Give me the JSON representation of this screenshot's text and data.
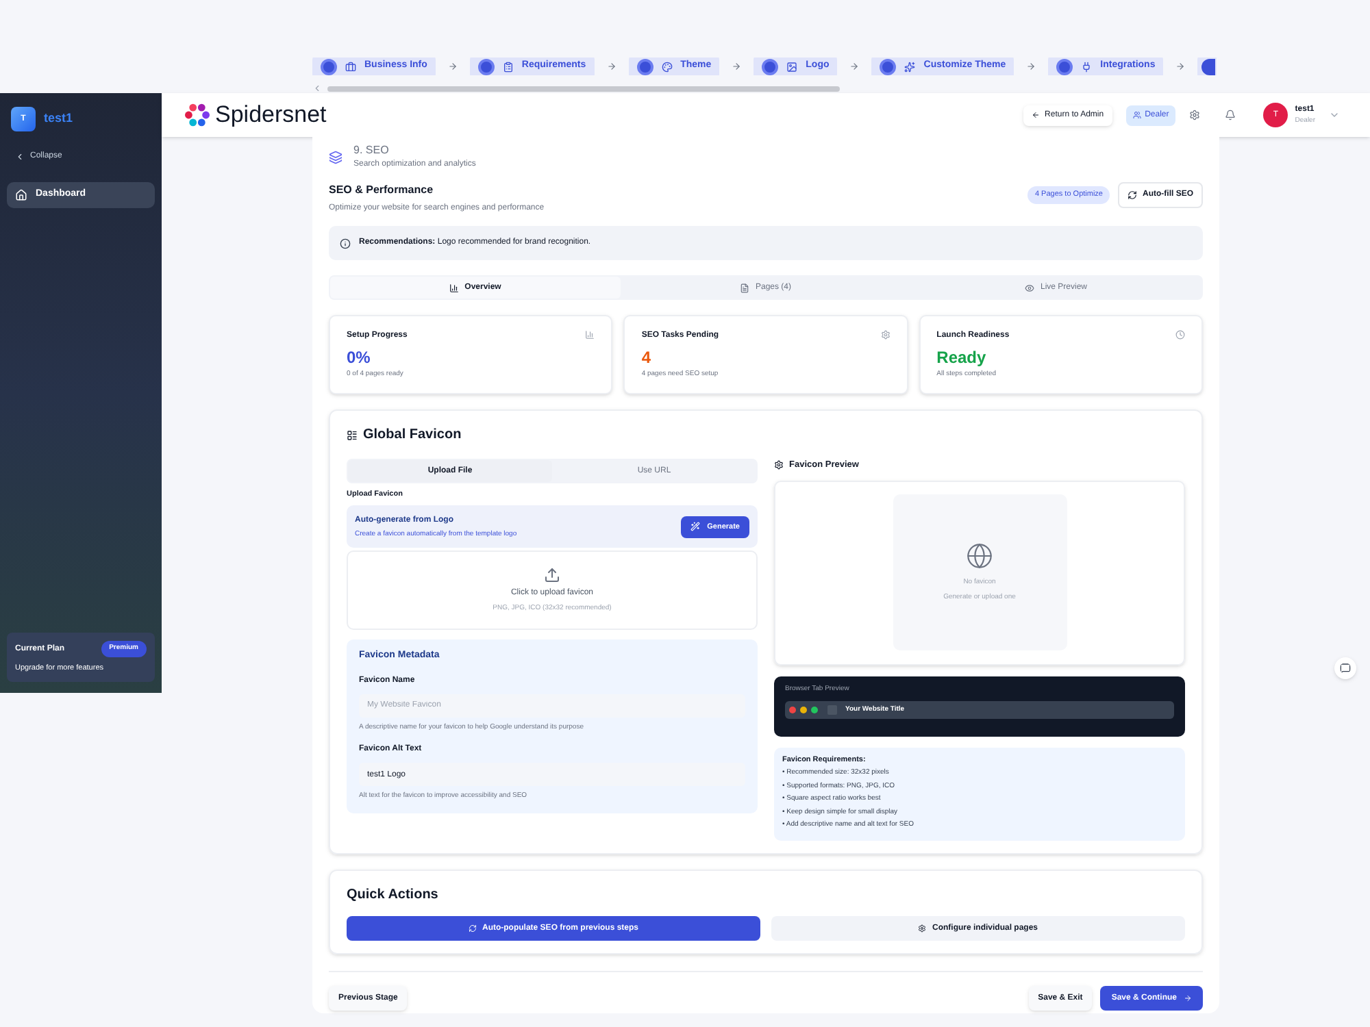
{
  "stepper": {
    "steps": [
      {
        "label": "Business Info"
      },
      {
        "label": "Requirements"
      },
      {
        "label": "Theme"
      },
      {
        "label": "Logo"
      },
      {
        "label": "Customize Theme"
      },
      {
        "label": "Integrations"
      }
    ]
  },
  "sidebar": {
    "avatar": "T",
    "name": "test1",
    "collapse": "Collapse",
    "items": [
      {
        "label": "Dashboard",
        "selected": true
      }
    ],
    "plan": {
      "label": "Current Plan",
      "badge": "Premium",
      "note": "Upgrade for more features"
    }
  },
  "header": {
    "brand": "Spidersnet",
    "return_button": "Return to Admin",
    "role_badge": "Dealer",
    "user": {
      "avatar": "T",
      "name": "test1",
      "role": "Dealer"
    }
  },
  "step": {
    "title": "9. SEO",
    "subtitle": "Search optimization and analytics"
  },
  "seo": {
    "title": "SEO & Performance",
    "subtitle": "Optimize your website for search engines and performance",
    "badge": "4 Pages to Optimize",
    "autofill_button": "Auto-fill SEO",
    "recommendation": "**Recommendations:** Logo recommended for brand recognition.",
    "tabs": [
      {
        "label": "Overview",
        "selected": true
      },
      {
        "label": "Pages (4)",
        "selected": false
      },
      {
        "label": "Live Preview",
        "selected": false
      }
    ],
    "stats": [
      {
        "label": "Setup Progress",
        "value": "0%",
        "note": "0 of 4 pages ready",
        "color": "#3b4fd8"
      },
      {
        "label": "SEO Tasks Pending",
        "value": "4",
        "note": "4 pages need SEO setup",
        "color": "#ea580c"
      },
      {
        "label": "Launch Readiness",
        "value": "Ready",
        "note": "All steps completed",
        "color": "#16a34a"
      }
    ]
  },
  "favicon": {
    "title": "Global Favicon",
    "tabs": [
      {
        "label": "Upload File",
        "selected": true
      },
      {
        "label": "Use URL",
        "selected": false
      }
    ],
    "upload_label": "Upload Favicon",
    "autogen": {
      "title": "Auto-generate from Logo",
      "subtitle": "Create a favicon automatically from the template logo",
      "button": "Generate"
    },
    "dropzone": {
      "title": "Click to upload favicon",
      "hint": "PNG, JPG, ICO (32x32 recommended)"
    },
    "metadata": {
      "title": "Favicon Metadata",
      "fields": [
        {
          "label": "Favicon Name",
          "placeholder": "My Website Favicon",
          "help": "A descriptive name for your favicon to help Google understand its purpose"
        },
        {
          "label": "Favicon Alt Text",
          "value": "test1 Logo",
          "help": "Alt text for the favicon to improve accessibility and SEO"
        }
      ]
    },
    "preview": {
      "title": "Favicon Preview",
      "empty_title": "No favicon",
      "empty_hint": "Generate or upload one",
      "browser_label": "Browser Tab Preview",
      "tab_title": "Your Website Title"
    },
    "requirements": {
      "title": "Favicon Requirements:",
      "items": [
        "• Recommended size: 32x32 pixels",
        "• Supported formats: PNG, JPG, ICO",
        "• Square aspect ratio works best",
        "• Keep design simple for small display",
        "• Add descriptive name and alt text for SEO"
      ]
    }
  },
  "quick_actions": {
    "title": "Quick Actions",
    "primary": "Auto-populate SEO from previous steps",
    "secondary": "Configure individual pages"
  },
  "footer": {
    "previous": "Previous Stage",
    "save_exit": "Save & Exit",
    "save_continue": "Save & Continue"
  }
}
